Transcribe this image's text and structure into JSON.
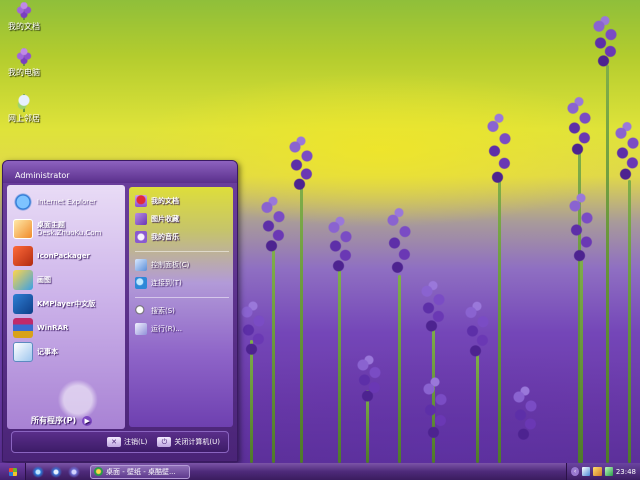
{
  "desktop": {
    "icons": [
      {
        "label": "我的文档",
        "icon": "my-documents-icon"
      },
      {
        "label": "我的电脑",
        "icon": "my-computer-icon"
      },
      {
        "label": "网上邻居",
        "icon": "network-places-icon"
      }
    ]
  },
  "start_menu": {
    "user": "Administrator",
    "programs": [
      {
        "label": "Internet Explorer",
        "sub": "",
        "icon": "internet-explorer-icon"
      },
      {
        "label": "桌面主题",
        "sub": "Desk.ZhuoKu.Com",
        "icon": "desktop-theme-icon"
      },
      {
        "label": "IconPackager",
        "sub": "",
        "icon": "iconpackager-icon"
      },
      {
        "label": "画图",
        "sub": "",
        "icon": "paint-icon"
      },
      {
        "label": "KMPlayer中文版",
        "sub": "",
        "icon": "kmplayer-icon"
      },
      {
        "label": "WinRAR",
        "sub": "",
        "icon": "winrar-icon"
      },
      {
        "label": "记事本",
        "sub": "",
        "icon": "notepad-icon"
      }
    ],
    "all_programs": "所有程序(P)",
    "places": [
      {
        "label": "我的文档",
        "icon": "my-documents-icon"
      },
      {
        "label": "图片收藏",
        "icon": "my-pictures-icon"
      },
      {
        "label": "我的音乐",
        "icon": "my-music-icon"
      },
      {
        "label": "控制面板(C)",
        "icon": "control-panel-icon"
      },
      {
        "label": "连接到(T)",
        "icon": "connect-to-icon"
      },
      {
        "label": "搜索(S)",
        "icon": "search-icon"
      },
      {
        "label": "运行(R)...",
        "icon": "run-icon"
      }
    ],
    "logoff": "注销(L)",
    "shutdown": "关闭计算机(U)"
  },
  "taskbar": {
    "task": "桌面 - 壁纸 - 桌酷壁...",
    "clock": "23:48"
  }
}
